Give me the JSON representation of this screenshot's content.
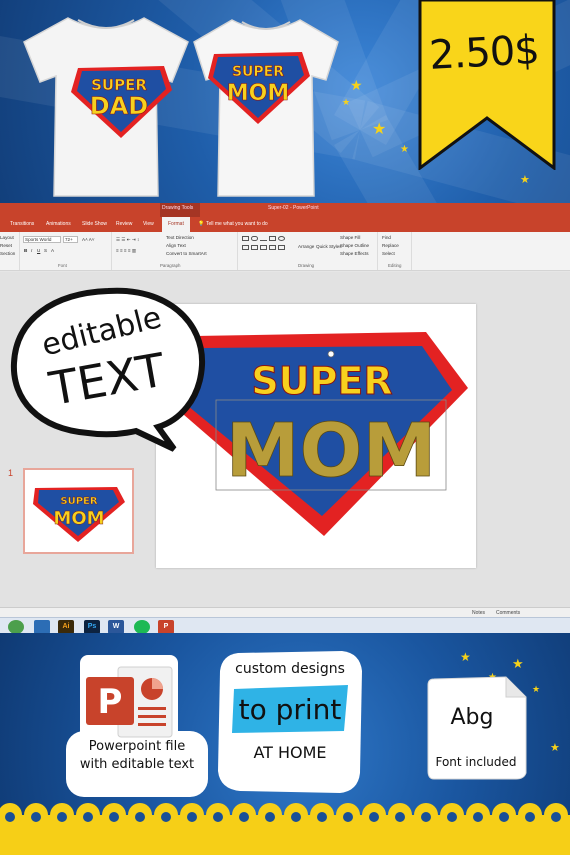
{
  "price": "2.50$",
  "shirts": {
    "left": {
      "line1": "SUPER",
      "line2": "DAD"
    },
    "right": {
      "line1": "SUPER",
      "line2": "MOM"
    }
  },
  "window": {
    "title": "Super-02 - PowerPoint",
    "context_tab": "Drawing Tools"
  },
  "tabs": [
    "Transitions",
    "Animations",
    "Slide Show",
    "Review",
    "View",
    "Format"
  ],
  "tell_me": "Tell me what you want to do",
  "ribbon": {
    "font_name": "Sports World",
    "font_size": "72+",
    "layout": "Layout",
    "reset": "Reset",
    "section": "Section",
    "font_group": "Font",
    "paragraph_group": "Paragraph",
    "drawing_group": "Drawing",
    "editing_group": "Editing",
    "text_direction": "Text Direction",
    "align_text": "Align Text",
    "convert_smartart": "Convert to SmartArt",
    "arrange": "Arrange",
    "quick_styles": "Quick Styles",
    "shape_fill": "Shape Fill",
    "shape_outline": "Shape Outline",
    "shape_effects": "Shape Effects",
    "find": "Find",
    "replace": "Replace",
    "select": "Select"
  },
  "slide": {
    "number": "1",
    "line1": "SUPER",
    "line2": "MOM"
  },
  "thumbnail": {
    "line1": "SUPER",
    "line2": "MOM"
  },
  "statusbar": {
    "notes": "Notes",
    "comments": "Comments"
  },
  "callout": {
    "line1": "editable",
    "line2": "TEXT"
  },
  "features": {
    "powerpoint_caption_1": "Powerpoint file",
    "powerpoint_caption_2": "with editable text",
    "ppt_letter": "P",
    "custom_line1": "custom designs",
    "custom_line2": "to print",
    "custom_line3": "AT HOME",
    "font_sample": "Abg",
    "font_caption": "Font included"
  },
  "colors": {
    "ppt_red": "#c8432b",
    "shield_blue": "#1f4fa3",
    "shield_red": "#e32222",
    "shield_yellow": "#f7d11e",
    "tag_yellow": "#f9d51a"
  }
}
